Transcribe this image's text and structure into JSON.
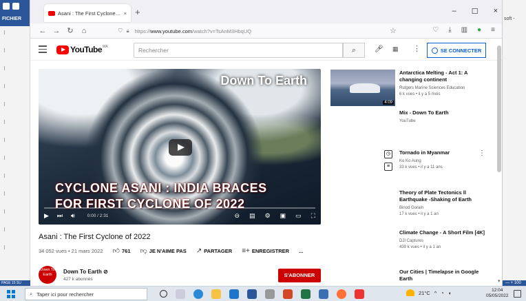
{
  "word": {
    "file_label": "FICHIER",
    "right_text": "soft -",
    "status": "PAGE 15 SU",
    "zoom": "— +  100"
  },
  "browser": {
    "tab_title": "Asani : The First Cyclone of 2022",
    "new_tab": "+",
    "url_prefix": "https://",
    "url_host": "www.youtube.com",
    "url_path": "/watch?v=TsAnM3HbqUQ"
  },
  "youtube": {
    "logo_text": "YouTube",
    "logo_country": "MA",
    "search_placeholder": "Rechercher",
    "signin_label": "SE CONNECTER"
  },
  "player": {
    "channel_watermark": "Down To Earth",
    "headline_line1": "CYCLONE ASANI : INDIA BRACES",
    "headline_line2": "FOR FIRST CYCLONE OF 2022",
    "time": "0:00 / 2:31",
    "progress": 0
  },
  "video": {
    "title": "Asani : The First Cyclone of 2022",
    "views": "34 052 vues • 21 mars 2022",
    "likes": "761",
    "dislike_label": "JE N'AIME PAS",
    "share_label": "PARTAGER",
    "save_label": "ENREGISTRER",
    "more": "..."
  },
  "channel": {
    "avatar_text": "Down To Earth",
    "name": "Down To Earth ⊘",
    "subs": "427 k abonnés",
    "subscribe_label": "S'ABONNER"
  },
  "recs": [
    {
      "title": "Antarctica Melting - Act 1: A changing continent",
      "channel": "Rutgers Marine Sciences Education",
      "meta": "6 k vues • il y a 5 mois",
      "duration": "4:09"
    },
    {
      "title": "Mix - Down To Earth",
      "channel": "YouTube",
      "meta": ""
    },
    {
      "title": "Tornado in Myanmar",
      "channel": "Ko Ko Aung",
      "meta": "33 k vues • il y a 11 ans"
    },
    {
      "title": "Theory of Plate Tectonics ll Earthquake -Shaking of Earth",
      "channel": "Binod Gorain",
      "meta": "17 k vues • il y a 1 an"
    },
    {
      "title": "Climate Change - A Short Film [4K]",
      "channel": "DJI Captures",
      "meta": "439 k vues • il y a 1 an"
    },
    {
      "title": "Our Cities | Timelapse in Google Earth",
      "channel": "",
      "meta": ""
    }
  ],
  "taskbar": {
    "search_placeholder": "Taper ici pour rechercher",
    "weather": "21°C",
    "time": "12:04",
    "date": "05/05/2022"
  },
  "colors": {
    "brand_red": "#ff0000",
    "link_blue": "#065fd4",
    "word_blue": "#2b579a"
  }
}
